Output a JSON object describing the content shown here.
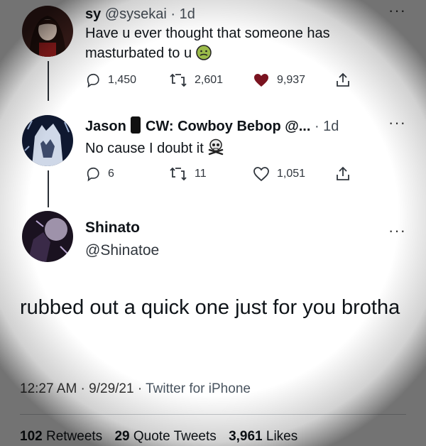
{
  "tweet1": {
    "name": "sy",
    "handle": "@sysekai",
    "time": "· 1d",
    "text": "Have u ever thought that someone has masturbated to u",
    "emoji": "nauseated-face",
    "replies": "1,450",
    "retweets": "2,601",
    "likes": "9,937",
    "liked": true
  },
  "tweet2": {
    "name": "Jason",
    "name_suffix": "CW: Cowboy Bebop @...",
    "time": "· 1d",
    "text": "No cause I doubt it",
    "emoji": "skull-crossbones",
    "replies": "6",
    "retweets": "11",
    "likes": "1,051"
  },
  "focus": {
    "name": "Shinato",
    "handle": "@Shinatoe",
    "text": "rubbed out a quick one just for you brotha",
    "time": "12:27 AM · 9/29/21",
    "source_sep": "·",
    "source": "Twitter for iPhone"
  },
  "stats": {
    "retweets_count": "102",
    "retweets_label": "Retweets",
    "quotes_count": "29",
    "quotes_label": "Quote Tweets",
    "likes_count": "3,961",
    "likes_label": "Likes"
  },
  "more_label": "···",
  "colors": {
    "like_filled": "#7a1320",
    "icon": "#30363d"
  }
}
